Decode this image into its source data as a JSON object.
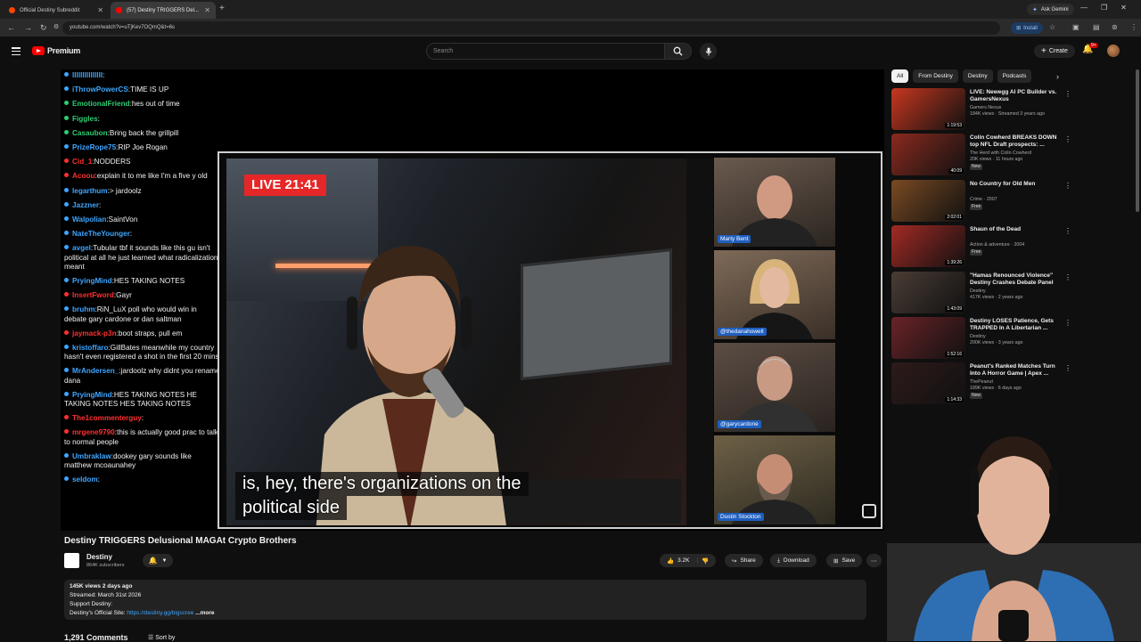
{
  "browser": {
    "tabs": [
      {
        "title": "Official Destiny Subreddit",
        "active": false,
        "favicon_color": "#ff4500"
      },
      {
        "title": "(57) Destiny TRIGGERS Del...",
        "active": true,
        "favicon_color": "#ff0000"
      }
    ],
    "new_tab_icon": "plus-icon",
    "ask_gemini_label": "Ask Gemini",
    "url": "youtube.com/watch?v=uTjKev7OQmQ&t=6s",
    "install_label": "Install"
  },
  "yt_header": {
    "logo_text": "Premium",
    "search_placeholder": "Search",
    "create_label": "Create",
    "notification_count": "9+"
  },
  "chat": [
    {
      "name": "lllllllllllllll",
      "msg": "",
      "color": "#3ea6ff"
    },
    {
      "name": "iThrowPowerCS",
      "msg": "TIME IS UP",
      "color": "#3ea6ff"
    },
    {
      "name": "EmotionalFriend",
      "msg": "hes out of time",
      "color": "#2ecc71"
    },
    {
      "name": "Figgles",
      "msg": "",
      "color": "#2ecc71"
    },
    {
      "name": "Casaubon",
      "msg": "Bring back the grillpill",
      "color": "#2ecc71"
    },
    {
      "name": "PrizeRope75",
      "msg": "RIP Joe Rogan",
      "color": "#3ea6ff"
    },
    {
      "name": "Cid_1",
      "msg": "NODDERS",
      "color": "#ff3030"
    },
    {
      "name": "Acoou",
      "msg": "explain it to me like I'm a five y old",
      "color": "#ff3030"
    },
    {
      "name": "legarthum",
      "msg": "> jardoolz",
      "color": "#3ea6ff"
    },
    {
      "name": "Jazzner",
      "msg": "",
      "color": "#3ea6ff"
    },
    {
      "name": "Walpolian",
      "msg": "SaintVon",
      "color": "#3ea6ff"
    },
    {
      "name": "NateTheYounger",
      "msg": "",
      "color": "#3ea6ff"
    },
    {
      "name": "avgel",
      "msg": "Tubular tbf it sounds like this gu isn't political at all he just learned what radicalization meant",
      "color": "#3ea6ff"
    },
    {
      "name": "PryingMind",
      "msg": "HES TAKING NOTES",
      "color": "#3ea6ff"
    },
    {
      "name": "InsertFword",
      "msg": "Gayr",
      "color": "#ff3030"
    },
    {
      "name": "bruhm",
      "msg": "RiN_LuX poll who would win in debate gary cardone or dan saltman",
      "color": "#3ea6ff"
    },
    {
      "name": "jaymack-p3n",
      "msg": "boot straps, pull em",
      "color": "#ff3030"
    },
    {
      "name": "kristoffaro",
      "msg": "GillBates meanwhile my country hasn't even registered a shot in the first 20 mins",
      "color": "#3ea6ff"
    },
    {
      "name": "MrAndersen_",
      "msg": "jardoolz why didnt you rename dana",
      "color": "#3ea6ff"
    },
    {
      "name": "PryingMind",
      "msg": "HES TAKING NOTES HE TAKING NOTES HES TAKING NOTES",
      "color": "#3ea6ff"
    },
    {
      "name": "The1commenterguy",
      "msg": "",
      "color": "#ff3030"
    },
    {
      "name": "mrgene9790",
      "msg": "this is actually good prac to talk to normal people",
      "color": "#ff3030"
    },
    {
      "name": "Umbraklaw",
      "msg": "dookey gary sounds like matthew mcoaunahey",
      "color": "#3ea6ff"
    },
    {
      "name": "seldom",
      "msg": "",
      "color": "#3ea6ff"
    }
  ],
  "video": {
    "live_badge": "LIVE 21:41",
    "caption_line1": "is, hey, there's organizations on the",
    "caption_line2": "political side",
    "participants": [
      "Marty Bent",
      "@thedanahowell",
      "@garycardone",
      "Dustin Stockton"
    ],
    "title": "Destiny TRIGGERS Delusional MAGAt Crypto Brothers",
    "channel": "Destiny",
    "subscribers": "864K subscribers",
    "likes": "3.2K",
    "share_label": "Share",
    "download_label": "Download",
    "save_label": "Save",
    "views_date": "145K views  2 days ago",
    "streamed": "Streamed: March 31st 2026",
    "support": "Support Destiny:",
    "official_site_label": "Destiny's Official Site:",
    "official_site_link": "https://destiny.gg/bigscree",
    "more_label": "...more",
    "comments_count": "1,291 Comments",
    "sort_label": "Sort by"
  },
  "sidebar": {
    "chips": [
      "All",
      "From Destiny",
      "Destiny",
      "Podcasts"
    ],
    "recommendations": [
      {
        "title": "LIVE: Newegg AI PC Builder vs. GamersNexus",
        "channel": "Gamers Nexus",
        "meta": "184K views · Streamed 3 years ago",
        "duration": "1:19:53",
        "tag": "",
        "thumb_color": "#c7371f"
      },
      {
        "title": "Colin Cowherd BREAKS DOWN top NFL Draft prospects: ...",
        "channel": "The Herd with Colin Cowherd",
        "meta": "20K views · 11 hours ago",
        "duration": "40:09",
        "tag": "New",
        "thumb_color": "#8a2a1f"
      },
      {
        "title": "No Country for Old Men",
        "channel": "Crime · 2007",
        "meta": "",
        "duration": "2:02:01",
        "tag": "Free",
        "thumb_color": "#7a4a22"
      },
      {
        "title": "Shaun of the Dead",
        "channel": "Action & adventure · 2004",
        "meta": "",
        "duration": "1:39:26",
        "tag": "Free",
        "thumb_color": "#a32a24"
      },
      {
        "title": "\"Hamas Renounced Violence\" Destiny Crashes Debate Panel",
        "channel": "Destiny",
        "meta": "417K views · 2 years ago",
        "duration": "1:43:09",
        "tag": "",
        "thumb_color": "#4a3d35"
      },
      {
        "title": "Destiny LOSES Patience, Gets TRAPPED In A Libertarian ...",
        "channel": "Destiny",
        "meta": "200K views · 3 years ago",
        "duration": "1:52:16",
        "tag": "",
        "thumb_color": "#6a2327"
      },
      {
        "title": "Peanut's Ranked Matches Turn Into A Horror Game | Apex ...",
        "channel": "ThePeanut",
        "meta": "189K views · 6 days ago",
        "duration": "1:14:33",
        "tag": "New",
        "thumb_color": "#2e1a1a"
      }
    ]
  },
  "colors": {
    "accent_red": "#ff0000",
    "live_red": "#e52727",
    "link_blue": "#3ea6ff"
  }
}
